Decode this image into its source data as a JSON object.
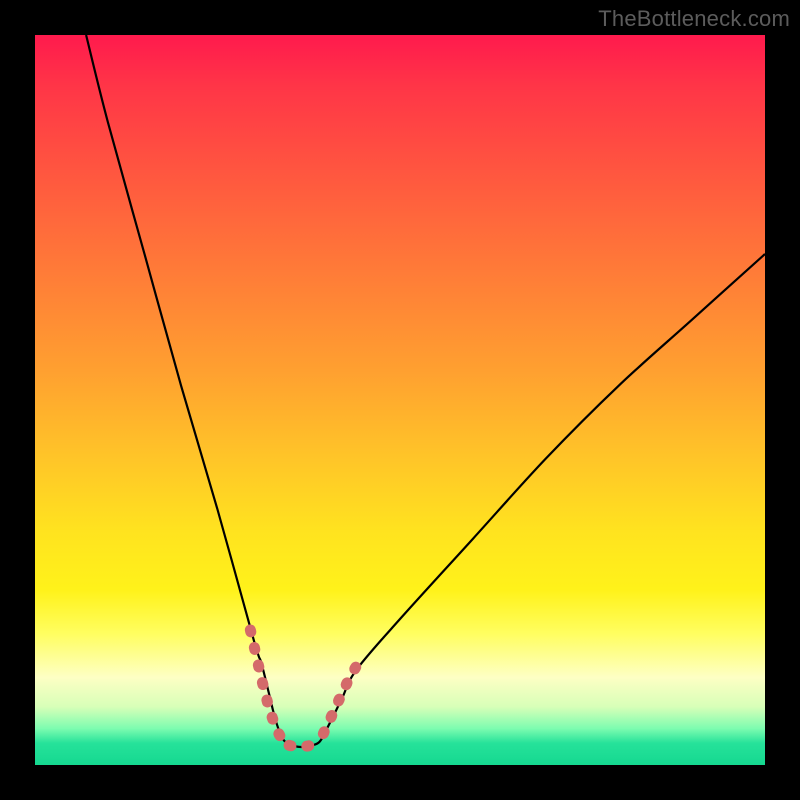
{
  "watermark": "TheBottleneck.com",
  "chart_data": {
    "type": "line",
    "title": "",
    "xlabel": "",
    "ylabel": "",
    "xlim": [
      0,
      100
    ],
    "ylim": [
      0,
      100
    ],
    "grid": false,
    "legend": false,
    "series": [
      {
        "name": "bottleneck-curve",
        "color": "#000000",
        "x": [
          7,
          10,
          15,
          20,
          25,
          30,
          31,
          32,
          33,
          34,
          35,
          36,
          37,
          38,
          39,
          40,
          42,
          44,
          50,
          60,
          70,
          80,
          90,
          100
        ],
        "y": [
          100,
          88,
          70,
          52,
          35,
          17,
          14,
          10,
          6,
          3.5,
          2.8,
          2.5,
          2.5,
          2.7,
          3.2,
          5,
          9,
          13,
          20,
          31,
          42,
          52,
          61,
          70
        ]
      }
    ],
    "markers": [
      {
        "name": "dashed-left-segment",
        "color": "#d46a6a",
        "style": "dashed",
        "x": [
          29.5,
          30.3,
          31.1,
          32.0,
          33.0,
          34.0,
          34.8
        ],
        "y": [
          18.5,
          15.0,
          11.5,
          8.0,
          5.0,
          3.2,
          2.7
        ]
      },
      {
        "name": "dashed-bottom-segment",
        "color": "#d46a6a",
        "style": "dashed",
        "x": [
          34.8,
          35.6,
          36.5,
          37.4,
          38.2
        ],
        "y": [
          2.7,
          2.5,
          2.5,
          2.6,
          2.9
        ]
      },
      {
        "name": "dashed-right-segment",
        "color": "#d46a6a",
        "style": "dashed",
        "x": [
          39.5,
          40.4,
          41.3,
          42.2,
          43.1,
          44.0
        ],
        "y": [
          4.3,
          6.2,
          8.2,
          10.1,
          12.0,
          13.5
        ]
      }
    ],
    "gradient_stops": [
      {
        "pos": 0.0,
        "color": "#ff1a4d"
      },
      {
        "pos": 0.18,
        "color": "#ff5440"
      },
      {
        "pos": 0.46,
        "color": "#ffa030"
      },
      {
        "pos": 0.68,
        "color": "#ffe31f"
      },
      {
        "pos": 0.88,
        "color": "#fdffc4"
      },
      {
        "pos": 1.0,
        "color": "#15d890"
      }
    ]
  }
}
